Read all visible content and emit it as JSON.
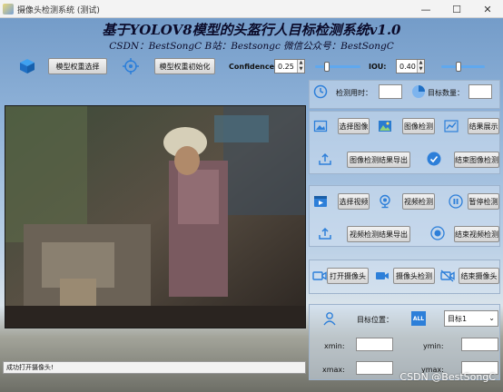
{
  "window": {
    "title": "摄像头检测系统 (测试)",
    "minimize": "—",
    "maximize": "☐",
    "close": "✕"
  },
  "header": {
    "title": "基于YOLOV8模型的头盔行人目标检测系统v1.0",
    "subtitle": "CSDN：BestSongC  B站：Bestsongc  微信公众号：BestSongC"
  },
  "toolbar": {
    "select_weights": "模型权重选择",
    "init_weights": "模型权重初始化",
    "confidence_label": "Confidence:",
    "confidence_value": "0.25",
    "confidence_level": 0.25,
    "iou_label": "IOU:",
    "iou_value": "0.40",
    "iou_level": 0.4
  },
  "stats": {
    "time_label": "检测用时：",
    "time_value": "",
    "count_label": "目标数量：",
    "count_value": ""
  },
  "image": {
    "select": "选择图像",
    "detect": "图像检测",
    "show_result": "结果展示",
    "export": "图像检测结果导出",
    "end": "结束图像检测"
  },
  "video": {
    "select": "选择视频",
    "detect": "视频检测",
    "pause": "暂停检测",
    "export": "视频检测结果导出",
    "end": "结束视频检测"
  },
  "camera": {
    "open": "打开摄像头",
    "detect": "摄像头检测",
    "end": "结束摄像头"
  },
  "target": {
    "label": "目标位置：",
    "all_badge": "ALL",
    "selected": "目标1",
    "xmin_label": "xmin:",
    "ymin_label": "ymin:",
    "xmax_label": "xmax:",
    "ymax_label": "ymax:",
    "xmin": "",
    "ymin": "",
    "xmax": "",
    "ymax": ""
  },
  "status": {
    "message": "成功打开摄像头!"
  },
  "watermark": "CSDN @BestSongC",
  "colors": {
    "accent": "#2d7fd9",
    "slider": "#5fa8ee"
  },
  "icons": [
    "cube-icon",
    "target-icon",
    "clock-icon",
    "pie-chart-icon",
    "image-icon",
    "gallery-icon",
    "chart-line-icon",
    "upload-icon",
    "check-circle-icon",
    "video-file-icon",
    "webcam-icon",
    "pause-icon",
    "record-icon",
    "camera-icon",
    "camera-off-icon",
    "person-icon",
    "all-icon"
  ]
}
